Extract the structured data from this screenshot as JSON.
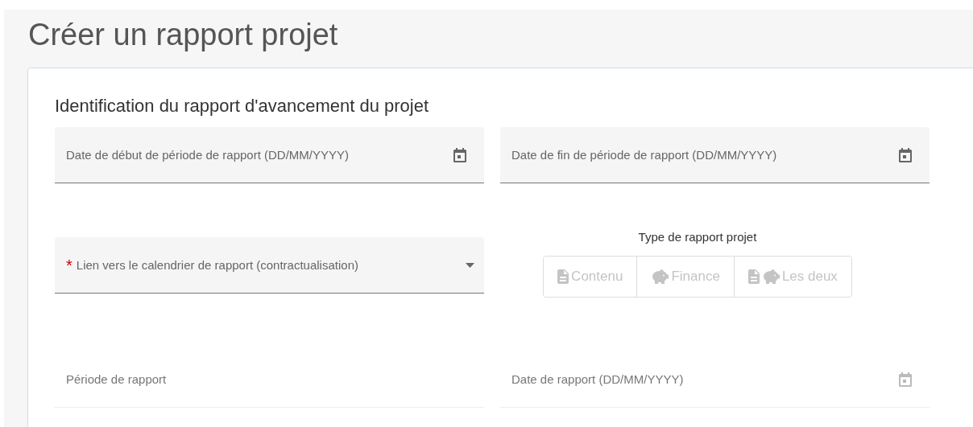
{
  "page_title": "Créer un rapport projet",
  "section": {
    "title": "Identification du rapport d'avancement du projet"
  },
  "fields": [
    {
      "kind": "date",
      "label": "Date de début de période de rapport (DD/MM/YYYY)",
      "disabled": false
    },
    {
      "kind": "date",
      "label": "Date de fin de période de rapport (DD/MM/YYYY)",
      "disabled": false
    },
    {
      "kind": "select",
      "label": "Lien vers le calendrier de rapport (contractualisation)",
      "required_mark": "*",
      "disabled": false
    },
    {
      "kind": "text",
      "label": "Période de rapport",
      "disabled": true
    },
    {
      "kind": "date",
      "label": "Date de rapport (DD/MM/YYYY)",
      "disabled": true
    }
  ],
  "report_type": {
    "label": "Type de rapport projet",
    "disabled": true,
    "options": [
      {
        "kind": "content",
        "label": "Contenu",
        "selected": false
      },
      {
        "kind": "finance",
        "label": "Finance",
        "selected": false
      },
      {
        "kind": "both",
        "label": "Les deux",
        "selected": false
      }
    ]
  }
}
